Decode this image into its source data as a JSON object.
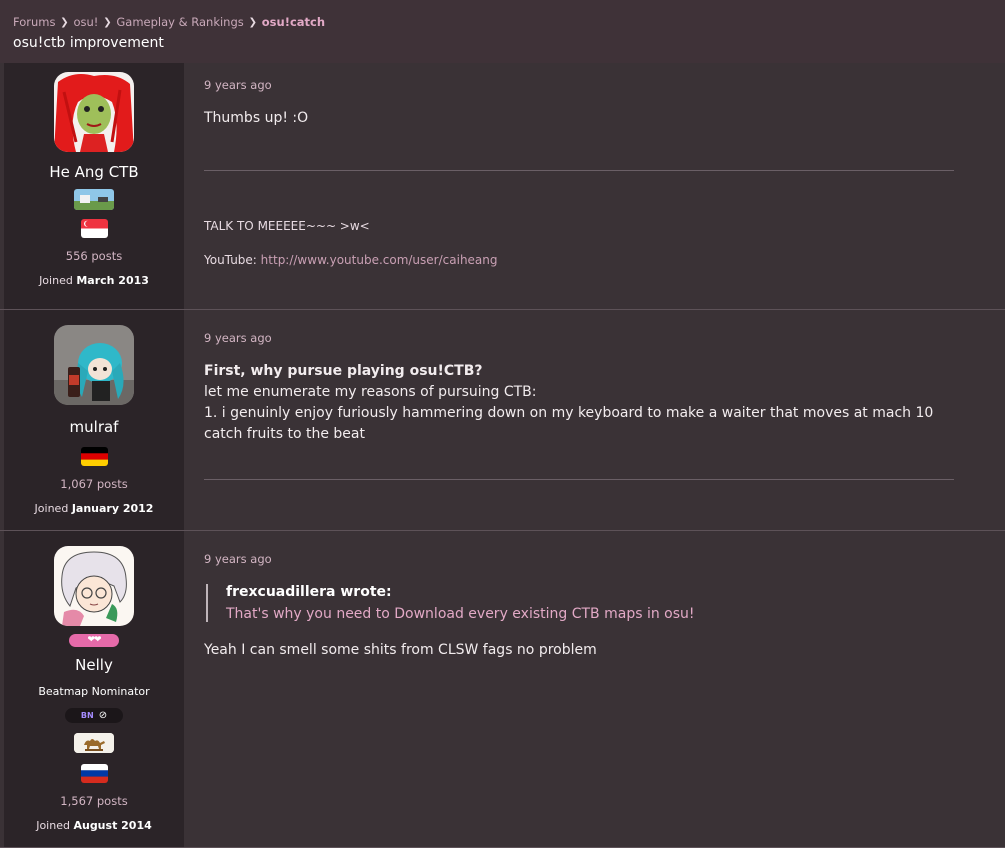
{
  "breadcrumb": [
    "Forums",
    "osu!",
    "Gameplay & Rankings",
    "osu!catch"
  ],
  "thread_title": "osu!ctb improvement",
  "posts": [
    {
      "username": "He Ang CTB",
      "post_count": "556 posts",
      "joined_label": "Joined",
      "joined_date": "March 2013",
      "country": "Singapore",
      "timestamp": "9 years ago",
      "body": "Thumbs up! :O",
      "signature_line1": "TALK TO MEEEEE~~~ >w<",
      "signature_label": "YouTube:",
      "signature_link": "http://www.youtube.com/user/caiheang"
    },
    {
      "username": "mulraf",
      "post_count": "1,067 posts",
      "joined_label": "Joined",
      "joined_date": "January 2012",
      "country": "Germany",
      "timestamp": "9 years ago",
      "heading": "First, why pursue playing osu!CTB?",
      "lines": [
        "let me enumerate my reasons of pursuing CTB:",
        "1. i genuinly enjoy furiously hammering down on my keyboard to make a waiter that moves at mach 10 catch fruits to the beat"
      ]
    },
    {
      "username": "Nelly",
      "role": "Beatmap Nominator",
      "bn_badge": "BN",
      "post_count": "1,567 posts",
      "joined_label": "Joined",
      "joined_date": "August 2014",
      "country": "Russia",
      "timestamp": "9 years ago",
      "quote_author": "frexcuadillera wrote:",
      "quote_text": "That's why you need to Download every existing CTB maps in osu!",
      "body": "Yeah I can smell some shits from CLSW fags no problem"
    }
  ],
  "colors": {
    "accent_pink": "#e2a9c6",
    "background": "#3a3236",
    "sidebar": "#2b2428",
    "header": "#3f3238",
    "heart_pill": "#e56aa9",
    "bn_purple": "#a58cff"
  }
}
